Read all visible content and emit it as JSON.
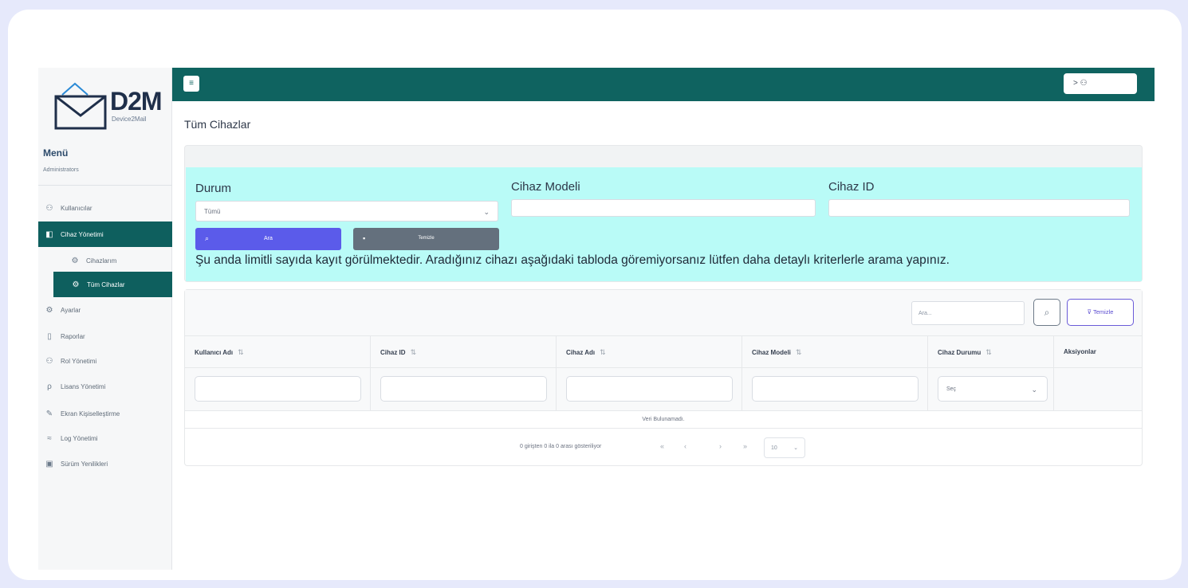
{
  "brand": {
    "name": "D2M",
    "sub": "Device2Mail"
  },
  "menu": {
    "title": "Menü",
    "role": "Administrators",
    "items": [
      {
        "label": "Kullanıcılar",
        "icon": "user-icon"
      },
      {
        "label": "Cihaz Yönetimi",
        "icon": "device-icon"
      },
      {
        "label": "Cihazlarım",
        "icon": "gear-icon"
      },
      {
        "label": "Tüm Cihazlar",
        "icon": "devices-icon"
      },
      {
        "label": "Ayarlar",
        "icon": "settings-icon"
      },
      {
        "label": "Raporlar",
        "icon": "report-icon"
      },
      {
        "label": "Rol Yönetimi",
        "icon": "role-icon"
      },
      {
        "label": "Lisans Yönetimi",
        "icon": "key-icon"
      },
      {
        "label": "Ekran Kişiselleştirme",
        "icon": "brush-icon"
      },
      {
        "label": "Log Yönetimi",
        "icon": "log-icon"
      },
      {
        "label": "Sürüm Yenilikleri",
        "icon": "release-icon"
      }
    ]
  },
  "topbar": {
    "menu_icon": "≡",
    "user_label": "> ⚇"
  },
  "page": {
    "title": "Tüm Cihazlar"
  },
  "filters": {
    "status_label": "Durum",
    "status_value": "Tümü",
    "model_label": "Cihaz Modeli",
    "model_value": "",
    "id_label": "Cihaz ID",
    "id_value": "",
    "search_label": "Ara",
    "clear_label": "Temizle",
    "notice": "Şu anda limitli sayıda kayıt görülmektedir. Aradığınız cihazı aşağıdaki tabloda göremiyorsanız lütfen daha detaylı kriterlerle arama yapınız."
  },
  "table": {
    "search_placeholder": "Ara...",
    "clear_label": "Temizle",
    "columns": [
      "Kullanıcı Adı",
      "Cihaz ID",
      "Cihaz Adı",
      "Cihaz Modeli",
      "Cihaz Durumu",
      "Aksiyonlar"
    ],
    "status_filter_value": "Seç",
    "empty_message": "Veri Bulunamadı.",
    "pagination_text": "0 girişten 0 ila 0 arası gösteriliyor",
    "page_size": "10"
  },
  "colors": {
    "primary": "#0f6360",
    "filter_bg": "#b9fbf7",
    "search_button": "#5b5bea",
    "clear_button": "#64707d"
  }
}
